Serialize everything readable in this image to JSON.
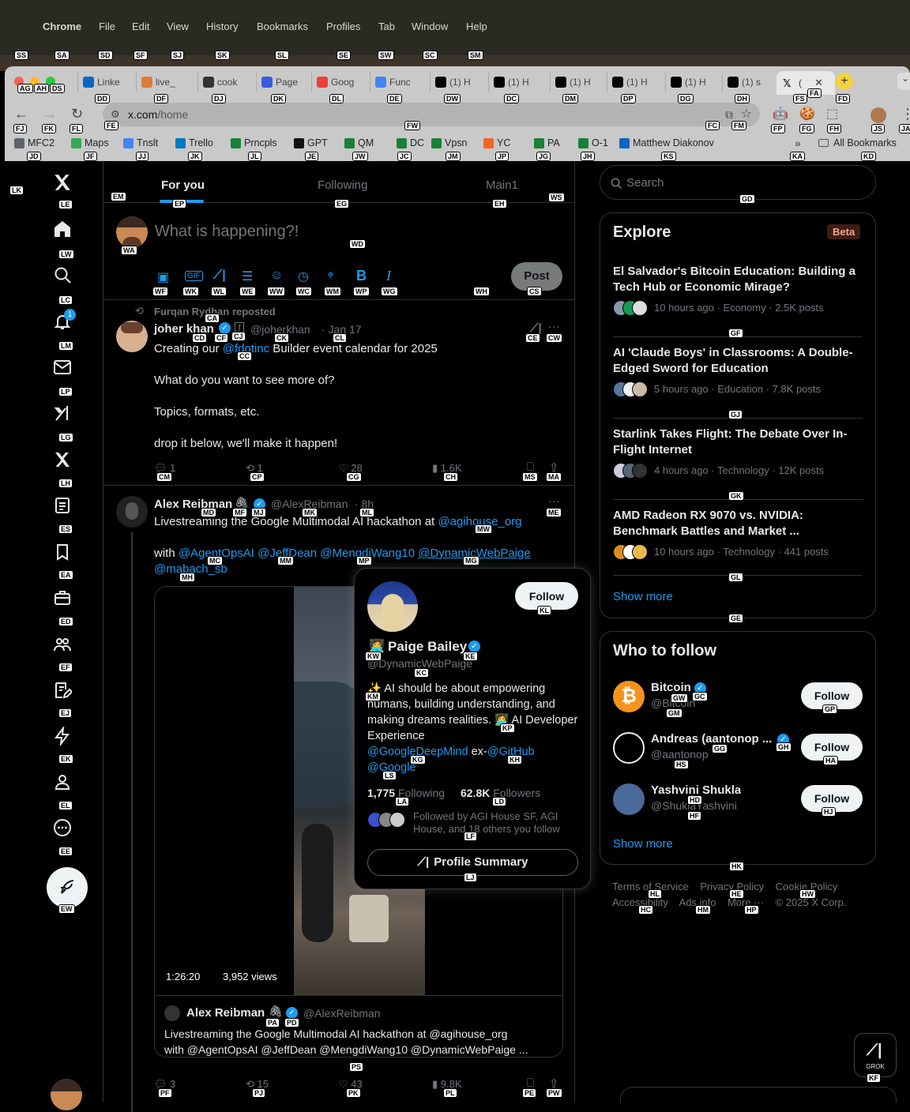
{
  "mac_menu": {
    "apple": "",
    "app": "Chrome",
    "items": [
      "File",
      "Edit",
      "View",
      "History",
      "Bookmarks",
      "Profiles",
      "Tab",
      "Window",
      "Help"
    ]
  },
  "tabs": [
    {
      "label": "Linke",
      "color": "#0a66c2"
    },
    {
      "label": "live_",
      "color": "#e07b39"
    },
    {
      "label": "cook",
      "color": "#333333"
    },
    {
      "label": "Page",
      "color": "#3b5bdb"
    },
    {
      "label": "Goog",
      "color": "#ea4335"
    },
    {
      "label": "Func",
      "color": "#4285f4"
    },
    {
      "label": "(1) H",
      "color": "#000000"
    },
    {
      "label": "(1) H",
      "color": "#000000"
    },
    {
      "label": "(1) H",
      "color": "#000000"
    },
    {
      "label": "(1) H",
      "color": "#000000"
    },
    {
      "label": "(1) H",
      "color": "#000000"
    },
    {
      "label": "(1) s",
      "color": "#000000"
    }
  ],
  "active_tab": {
    "label": "(",
    "close": "✕"
  },
  "new_tab": "+",
  "url": "x.com/home",
  "url_display": {
    "host": "x.com",
    "path": "/home"
  },
  "bookmarks": [
    {
      "label": "MFC2",
      "color": "#5f6368"
    },
    {
      "label": "Maps",
      "color": "#34a853"
    },
    {
      "label": "Tnslt",
      "color": "#4285f4"
    },
    {
      "label": "Trello",
      "color": "#0079bf"
    },
    {
      "label": "Prncpls",
      "color": "#188038"
    },
    {
      "label": "GPT",
      "color": "#111111"
    },
    {
      "label": "QM",
      "color": "#188038"
    },
    {
      "label": "DC",
      "color": "#188038"
    },
    {
      "label": "Vpsn",
      "color": "#188038"
    },
    {
      "label": "YC",
      "color": "#f26522"
    },
    {
      "label": "PA",
      "color": "#188038"
    },
    {
      "label": "O-1",
      "color": "#188038"
    },
    {
      "label": "Matthew Diakonov",
      "color": "#0a66c2"
    }
  ],
  "bookmarks_more": "»",
  "all_bookmarks": "All Bookmarks",
  "nav": {
    "notification_count": "1"
  },
  "feed_tabs": [
    "For you",
    "Following",
    "Main1"
  ],
  "compose": {
    "placeholder": "What is happening?!",
    "post": "Post"
  },
  "tweet1": {
    "repost_by": "Furqan Rydhan reposted",
    "name": "joher khan",
    "handle": "@joherkhan",
    "date": "· Jan 17",
    "line1_pre": "Creating our ",
    "line1_link": "@fdotinc",
    "line1_post": " Builder event calendar for 2025",
    "line2": "What do you want to see more of?",
    "line3": "Topics, formats, etc.",
    "line4": "drop it below, we'll make it happen!",
    "replies": "1",
    "reposts": "1",
    "likes": "28",
    "views": "1.6K"
  },
  "tweet2": {
    "name": "Alex Reibman",
    "emoji": "🖇",
    "handle": "@AlexReibman",
    "date": "· 8h",
    "text_pre": "Livestreaming the Google Multimodal AI hackathon at ",
    "text_link": "@agihouse_org",
    "with": "with ",
    "m1": "@AgentOpsAI",
    "m2": "@JeffDean",
    "m3": "@MengdiWang10",
    "m4": "@DynamicWebPaige",
    "m5": "@mabach_sb",
    "video_time": "1:26:20",
    "video_views": "3,952 views",
    "quote_name": "Alex Reibman",
    "quote_handle": "@AlexReibman",
    "quote_line1": "Livestreaming the Google Multimodal AI hackathon at @agihouse_org",
    "quote_line2": "with @AgentOpsAI @JeffDean @MengdiWang10 @DynamicWebPaige ...",
    "replies": "3",
    "reposts": "15",
    "likes": "43",
    "views": "9.8K"
  },
  "hovercard": {
    "follow": "Follow",
    "emoji": "👩‍💻",
    "name": "Paige Bailey",
    "handle": "@DynamicWebPaige",
    "bio_a": "✨ AI should be about empowering humans, building understanding, and making dreams realities. 👩‍💻 AI Developer Experience",
    "bio_link1": "@GoogleDeepMind",
    "bio_mid": " ex-",
    "bio_link2": "@GitHub",
    "bio_link3": "@Google",
    "following_count": "1,775",
    "following_label": "Following",
    "followers_count": "62.8K",
    "followers_label": "Followers",
    "followed_by": "Followed by AGI House SF, AGI House, and 18 others you follow",
    "summary": "Profile Summary"
  },
  "search": {
    "placeholder": "Search"
  },
  "explore": {
    "title": "Explore",
    "badge": "Beta",
    "items": [
      {
        "title": "El Salvador's Bitcoin Education: Building a Tech Hub or Economic Mirage?",
        "meta": "10 hours ago · Economy · 2.5K posts"
      },
      {
        "title": "AI 'Claude Boys' in Classrooms: A Double-Edged Sword for Education",
        "meta": "5 hours ago · Education · 7.8K posts"
      },
      {
        "title": "Starlink Takes Flight: The Debate Over In-Flight Internet",
        "meta": "4 hours ago · Technology · 12K posts"
      },
      {
        "title": "AMD Radeon RX 9070 vs. NVIDIA: Benchmark Battles and Market ...",
        "meta": "10 hours ago · Technology · 441 posts"
      }
    ],
    "show_more": "Show more"
  },
  "who_to_follow": {
    "title": "Who to follow",
    "items": [
      {
        "name": "Bitcoin",
        "handle": "@Bitcoin",
        "button": "Follow",
        "color": "#f7931a"
      },
      {
        "name": "Andreas (aantonop ...",
        "handle": "@aantonop",
        "button": "Follow",
        "color": "#eeeeee"
      },
      {
        "name": "Yashvini Shukla",
        "handle": "@ShuklaYashvini",
        "button": "Follow",
        "color": "#4a6a9a"
      }
    ],
    "show_more": "Show more"
  },
  "footer": {
    "l1": [
      "Terms of Service",
      "Privacy Policy",
      "Cookie Policy"
    ],
    "l2": [
      "Accessibility",
      "Ads info",
      "More ···",
      "© 2025 X Corp."
    ]
  },
  "grok": "GROK",
  "hint_labels": [
    "SS",
    "SA",
    "SD",
    "SF",
    "SJ",
    "SK",
    "SL",
    "SE",
    "SW",
    "SC",
    "SM",
    "AG",
    "AH",
    "DS",
    "DD",
    "DF",
    "DJ",
    "DK",
    "DL",
    "DE",
    "DW",
    "DC",
    "DM",
    "DP",
    "DG",
    "DH",
    "FS",
    "FA",
    "FD",
    "FJ",
    "FK",
    "FL",
    "FE",
    "FW",
    "FC",
    "FM",
    "FP",
    "FG",
    "FH",
    "JS",
    "JA",
    "JD",
    "JF",
    "JJ",
    "JK",
    "JL",
    "JE",
    "JW",
    "JC",
    "JM",
    "JP",
    "JG",
    "JH",
    "KS",
    "KA",
    "KD",
    "LK",
    "LE",
    "LW",
    "LC",
    "LM",
    "LP",
    "LG",
    "LH",
    "ES",
    "EA",
    "ED",
    "EF",
    "EJ",
    "EK",
    "EL",
    "EE",
    "EW",
    "EM",
    "EP",
    "EG",
    "EH",
    "WS",
    "WA",
    "WD",
    "WF",
    "WK",
    "WL",
    "WE",
    "WW",
    "WC",
    "WM",
    "WP",
    "WG",
    "WH",
    "CS",
    "CA",
    "CD",
    "CF",
    "CJ",
    "CK",
    "CL",
    "CC",
    "CE",
    "CW",
    "CM",
    "CP",
    "CG",
    "CH",
    "MS",
    "MA",
    "MD",
    "MF",
    "MJ",
    "MK",
    "ML",
    "ME",
    "MW",
    "MC",
    "MM",
    "MP",
    "MG",
    "MH",
    "KL",
    "KW",
    "KE",
    "KC",
    "KM",
    "KP",
    "KG",
    "KH",
    "LS",
    "LA",
    "LD",
    "LF",
    "LJ",
    "PA",
    "PD",
    "PS",
    "PF",
    "PJ",
    "PK",
    "PL",
    "PE",
    "PW",
    "GD",
    "GF",
    "GJ",
    "GK",
    "GL",
    "GE",
    "GW",
    "GC",
    "GM",
    "GP",
    "GG",
    "GH",
    "HS",
    "HA",
    "HD",
    "HF",
    "HJ",
    "HK",
    "HL",
    "HE",
    "HW",
    "HC",
    "HM",
    "HP",
    "KF"
  ]
}
